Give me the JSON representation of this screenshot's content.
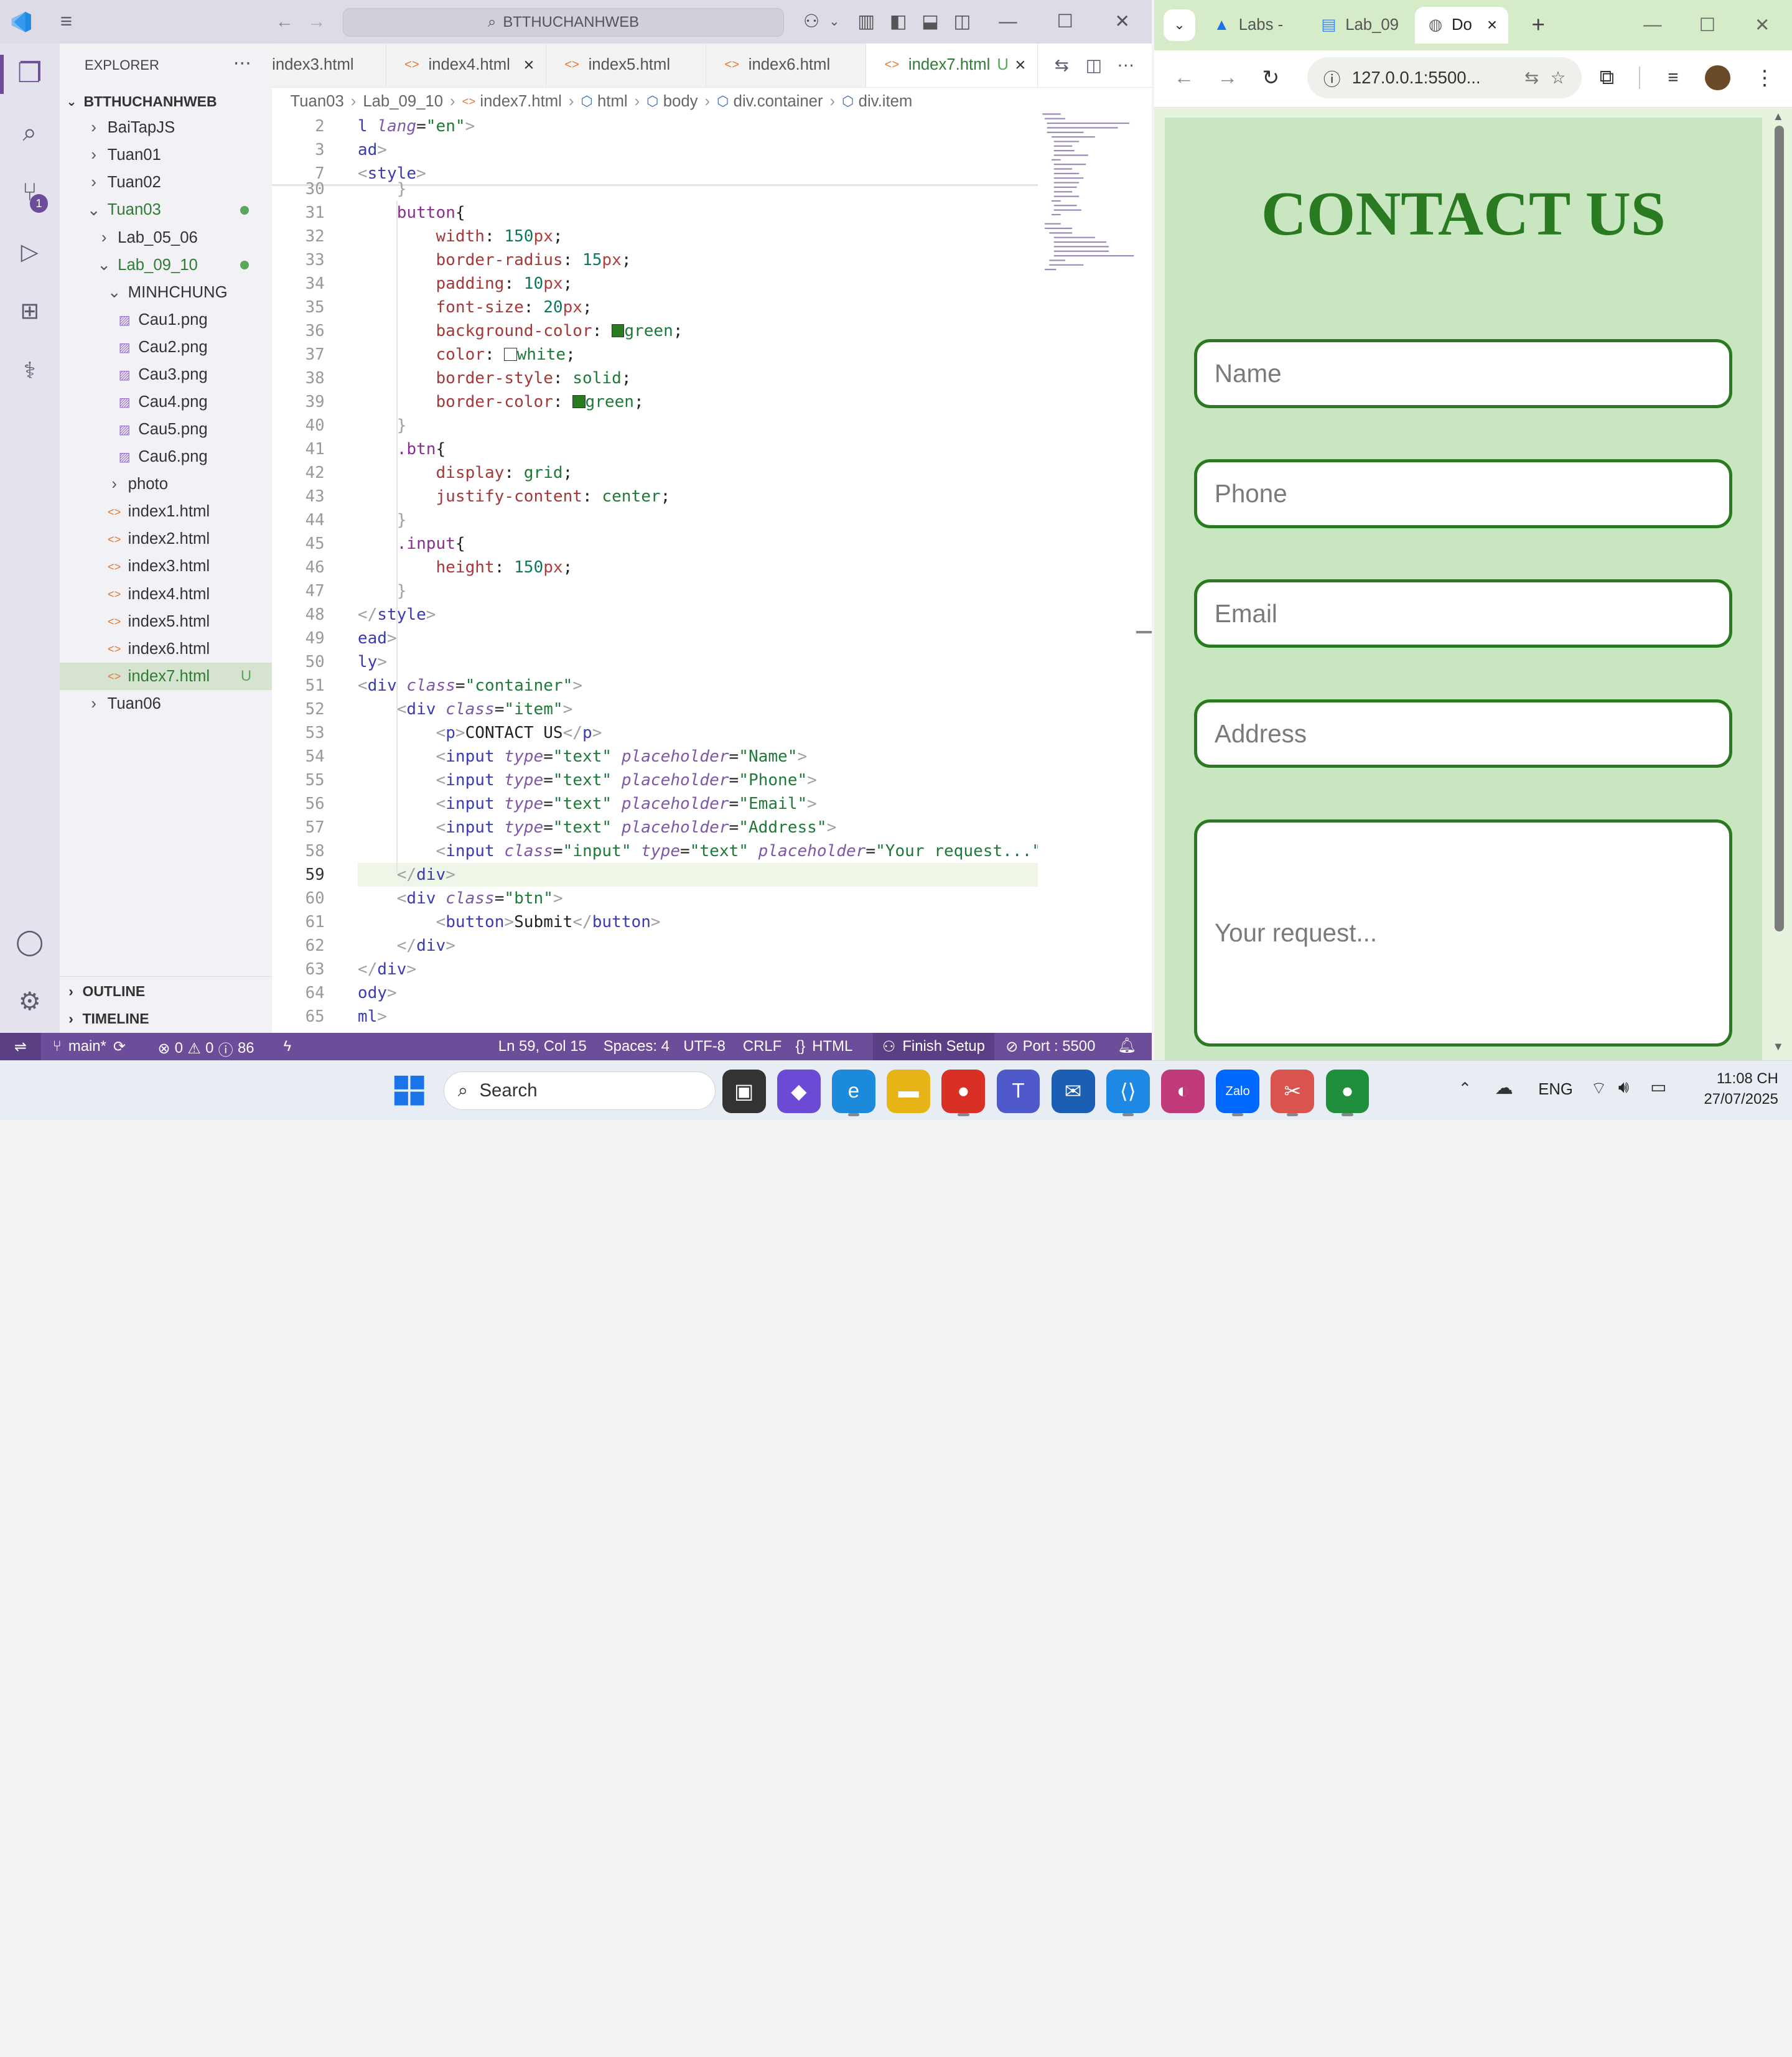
{
  "vscode": {
    "search": "BTTHUCHANHWEB",
    "explorer_title": "EXPLORER",
    "root_folder": "BTTHUCHANHWEB",
    "scm_badge": "1",
    "tree": [
      {
        "label": "BaiTapJS",
        "kind": "folder",
        "open": false,
        "indent": 0
      },
      {
        "label": "Tuan01",
        "kind": "folder",
        "open": false,
        "indent": 0
      },
      {
        "label": "Tuan02",
        "kind": "folder",
        "open": false,
        "indent": 0
      },
      {
        "label": "Tuan03",
        "kind": "folder",
        "open": true,
        "indent": 0,
        "modified": true
      },
      {
        "label": "Lab_05_06",
        "kind": "folder",
        "open": false,
        "indent": 1
      },
      {
        "label": "Lab_09_10",
        "kind": "folder",
        "open": true,
        "indent": 1,
        "modified": true
      },
      {
        "label": "MINHCHUNG",
        "kind": "folder",
        "open": true,
        "indent": 2
      },
      {
        "label": "Cau1.png",
        "kind": "image",
        "indent": 3
      },
      {
        "label": "Cau2.png",
        "kind": "image",
        "indent": 3
      },
      {
        "label": "Cau3.png",
        "kind": "image",
        "indent": 3
      },
      {
        "label": "Cau4.png",
        "kind": "image",
        "indent": 3
      },
      {
        "label": "Cau5.png",
        "kind": "image",
        "indent": 3
      },
      {
        "label": "Cau6.png",
        "kind": "image",
        "indent": 3
      },
      {
        "label": "photo",
        "kind": "folder",
        "open": false,
        "indent": 2
      },
      {
        "label": "index1.html",
        "kind": "html",
        "indent": 2
      },
      {
        "label": "index2.html",
        "kind": "html",
        "indent": 2
      },
      {
        "label": "index3.html",
        "kind": "html",
        "indent": 2
      },
      {
        "label": "index4.html",
        "kind": "html",
        "indent": 2
      },
      {
        "label": "index5.html",
        "kind": "html",
        "indent": 2
      },
      {
        "label": "index6.html",
        "kind": "html",
        "indent": 2
      },
      {
        "label": "index7.html",
        "kind": "html",
        "indent": 2,
        "selected": true,
        "badge": "U"
      },
      {
        "label": "Tuan06",
        "kind": "folder",
        "open": false,
        "indent": 0
      }
    ],
    "outline": "OUTLINE",
    "timeline": "TIMELINE",
    "tabs": [
      {
        "label": "index3.html"
      },
      {
        "label": "index4.html",
        "close": "×"
      },
      {
        "label": "index5.html"
      },
      {
        "label": "index6.html"
      },
      {
        "label": "index7.html",
        "badge": "U",
        "close": "×",
        "active": true
      }
    ],
    "breadcrumb": [
      "Tuan03",
      "Lab_09_10",
      "index7.html",
      "html",
      "body",
      "div.container",
      "div.item"
    ],
    "sticky_lines": [
      {
        "num": "2",
        "html": "<span class=\"t\">l</span> <span class=\"a\">lang</span>=<span class=\"v\">\"en\"</span><span class=\"p\">&gt;</span>"
      },
      {
        "num": "3",
        "html": "<span class=\"t\">ad</span><span class=\"p\">&gt;</span>"
      },
      {
        "num": "7",
        "html": "<span class=\"p\">&lt;</span><span class=\"t\">style</span><span class=\"p\">&gt;</span>"
      }
    ],
    "code_lines": [
      {
        "num": "30",
        "html": "    <span class=\"p\">}</span>"
      },
      {
        "num": "31",
        "html": "    <span class=\"k\">button</span>{"
      },
      {
        "num": "32",
        "html": "        <span class=\"pr\">width</span>: <span class=\"n\">150</span><span class=\"u\">px</span>;"
      },
      {
        "num": "33",
        "html": "        <span class=\"pr\">border-radius</span>: <span class=\"n\">15</span><span class=\"u\">px</span>;"
      },
      {
        "num": "34",
        "html": "        <span class=\"pr\">padding</span>: <span class=\"n\">10</span><span class=\"u\">px</span>;"
      },
      {
        "num": "35",
        "html": "        <span class=\"pr\">font-size</span>: <span class=\"n\">20</span><span class=\"u\">px</span>;"
      },
      {
        "num": "36",
        "html": "        <span class=\"pr\">background-color</span>: <span style=\"display:inline-block;width:11px;height:11px;background:#2a7a22;border:1px solid #333;vertical-align:-1px\"></span><span class=\"v\">green</span>;"
      },
      {
        "num": "37",
        "html": "        <span class=\"pr\">color</span>: <span style=\"display:inline-block;width:11px;height:11px;background:#fff;border:1px solid #333;vertical-align:-1px\"></span><span class=\"v\">white</span>;"
      },
      {
        "num": "38",
        "html": "        <span class=\"pr\">border-style</span>: <span class=\"v\">solid</span>;"
      },
      {
        "num": "39",
        "html": "        <span class=\"pr\">border-color</span>: <span style=\"display:inline-block;width:11px;height:11px;background:#2a7a22;border:1px solid #333;vertical-align:-1px\"></span><span class=\"v\">green</span>;"
      },
      {
        "num": "40",
        "html": "    <span class=\"p\">}</span>"
      },
      {
        "num": "41",
        "html": "    <span class=\"k\">.btn</span>{"
      },
      {
        "num": "42",
        "html": "        <span class=\"pr\">display</span>: <span class=\"v\">grid</span>;"
      },
      {
        "num": "43",
        "html": "        <span class=\"pr\">justify-content</span>: <span class=\"v\">center</span>;"
      },
      {
        "num": "44",
        "html": "    <span class=\"p\">}</span>"
      },
      {
        "num": "45",
        "html": "    <span class=\"k\">.input</span>{"
      },
      {
        "num": "46",
        "html": "        <span class=\"pr\">height</span>: <span class=\"n\">150</span><span class=\"u\">px</span>;"
      },
      {
        "num": "47",
        "html": "    <span class=\"p\">}</span>"
      },
      {
        "num": "48",
        "html": "<span class=\"p\">&lt;/</span><span class=\"t\">style</span><span class=\"p\">&gt;</span>"
      },
      {
        "num": "49",
        "html": "<span class=\"t\">ead</span><span class=\"p\">&gt;</span>"
      },
      {
        "num": "50",
        "html": "<span class=\"t\">ly</span><span class=\"p\">&gt;</span>"
      },
      {
        "num": "51",
        "html": "<span class=\"p\">&lt;</span><span class=\"t\">div</span> <span class=\"a\">class</span>=<span class=\"v\">\"container\"</span><span class=\"p\">&gt;</span>"
      },
      {
        "num": "52",
        "html": "    <span class=\"p\">&lt;</span><span class=\"t\">div</span> <span class=\"a\">class</span>=<span class=\"v\">\"item\"</span><span class=\"p\">&gt;</span>"
      },
      {
        "num": "53",
        "html": "        <span class=\"p\">&lt;</span><span class=\"t\">p</span><span class=\"p\">&gt;</span>CONTACT US<span class=\"p\">&lt;/</span><span class=\"t\">p</span><span class=\"p\">&gt;</span>"
      },
      {
        "num": "54",
        "html": "        <span class=\"p\">&lt;</span><span class=\"t\">input</span> <span class=\"a\">type</span>=<span class=\"v\">\"text\"</span> <span class=\"a\">placeholder</span>=<span class=\"v\">\"Name\"</span><span class=\"p\">&gt;</span>"
      },
      {
        "num": "55",
        "html": "        <span class=\"p\">&lt;</span><span class=\"t\">input</span> <span class=\"a\">type</span>=<span class=\"v\">\"text\"</span> <span class=\"a\">placeholder</span>=<span class=\"v\">\"Phone\"</span><span class=\"p\">&gt;</span>"
      },
      {
        "num": "56",
        "html": "        <span class=\"p\">&lt;</span><span class=\"t\">input</span> <span class=\"a\">type</span>=<span class=\"v\">\"text\"</span> <span class=\"a\">placeholder</span>=<span class=\"v\">\"Email\"</span><span class=\"p\">&gt;</span>"
      },
      {
        "num": "57",
        "html": "        <span class=\"p\">&lt;</span><span class=\"t\">input</span> <span class=\"a\">type</span>=<span class=\"v\">\"text\"</span> <span class=\"a\">placeholder</span>=<span class=\"v\">\"Address\"</span><span class=\"p\">&gt;</span>"
      },
      {
        "num": "58",
        "html": "        <span class=\"p\">&lt;</span><span class=\"t\">input</span> <span class=\"a\">class</span>=<span class=\"v\">\"input\"</span> <span class=\"a\">type</span>=<span class=\"v\">\"text\"</span> <span class=\"a\">placeholder</span>=<span class=\"v\">\"Your request...\"</span><span class=\"p\">&gt;</span>"
      },
      {
        "num": "59",
        "html": "    <span class=\"p\">&lt;/</span><span class=\"t\">div</span><span class=\"p\">&gt;</span>",
        "current": true
      },
      {
        "num": "60",
        "html": "    <span class=\"p\">&lt;</span><span class=\"t\">div</span> <span class=\"a\">class</span>=<span class=\"v\">\"btn\"</span><span class=\"p\">&gt;</span>"
      },
      {
        "num": "61",
        "html": "        <span class=\"p\">&lt;</span><span class=\"t\">button</span><span class=\"p\">&gt;</span>Submit<span class=\"p\">&lt;/</span><span class=\"t\">button</span><span class=\"p\">&gt;</span>"
      },
      {
        "num": "62",
        "html": "    <span class=\"p\">&lt;/</span><span class=\"t\">div</span><span class=\"p\">&gt;</span>"
      },
      {
        "num": "63",
        "html": "<span class=\"p\">&lt;/</span><span class=\"t\">div</span><span class=\"p\">&gt;</span>"
      },
      {
        "num": "64",
        "html": "<span class=\"t\">ody</span><span class=\"p\">&gt;</span>"
      },
      {
        "num": "65",
        "html": "<span class=\"t\">ml</span><span class=\"p\">&gt;</span>"
      }
    ],
    "status": {
      "branch": "main*",
      "errors": "0",
      "warnings": "0",
      "infos": "86",
      "position": "Ln 59, Col 15",
      "spaces": "Spaces: 4",
      "encoding": "UTF-8",
      "eol": "CRLF",
      "language": "HTML",
      "finish_setup": "Finish Setup",
      "port": "Port : 5500"
    }
  },
  "browser": {
    "tabs": [
      {
        "label": "Labs - ",
        "icon": "drive-icon"
      },
      {
        "label": "Lab_09",
        "icon": "docs-icon"
      },
      {
        "label": "Do",
        "icon": "globe-icon",
        "active": true,
        "close": "×"
      }
    ],
    "new_tab": "+",
    "url": "127.0.0.1:5500...",
    "page": {
      "heading": "CONTACT US",
      "fields": [
        {
          "placeholder": "Name"
        },
        {
          "placeholder": "Phone"
        },
        {
          "placeholder": "Email"
        },
        {
          "placeholder": "Address"
        },
        {
          "placeholder": "Your request..."
        }
      ],
      "accent": "#2a7a22",
      "background": "#c8e6c0"
    }
  },
  "taskbar": {
    "search": "Search",
    "lang": "ENG",
    "time": "11:08 CH",
    "date": "27/07/2025",
    "apps": [
      {
        "name": "task-view",
        "label": "▣",
        "color": "#333"
      },
      {
        "name": "copilot",
        "label": "◆",
        "color": "#6b4bd6"
      },
      {
        "name": "edge",
        "label": "e",
        "color": "#1b8adb"
      },
      {
        "name": "explorer",
        "label": "▬",
        "color": "#e7b418"
      },
      {
        "name": "chrome",
        "label": "●",
        "color": "#d93025"
      },
      {
        "name": "teams",
        "label": "T",
        "color": "#5059c9"
      },
      {
        "name": "mail",
        "label": "✉",
        "color": "#1a5fb4"
      },
      {
        "name": "vscode",
        "label": "⟨⟩",
        "color": "#1e88e5"
      },
      {
        "name": "app-red",
        "label": "◐",
        "color": "#c0397a"
      },
      {
        "name": "zalo",
        "label": "Zalo",
        "color": "#0068ff"
      },
      {
        "name": "snip",
        "label": "✂",
        "color": "#d9534f"
      },
      {
        "name": "chrome2",
        "label": "●",
        "color": "#1f8e3d"
      }
    ]
  }
}
